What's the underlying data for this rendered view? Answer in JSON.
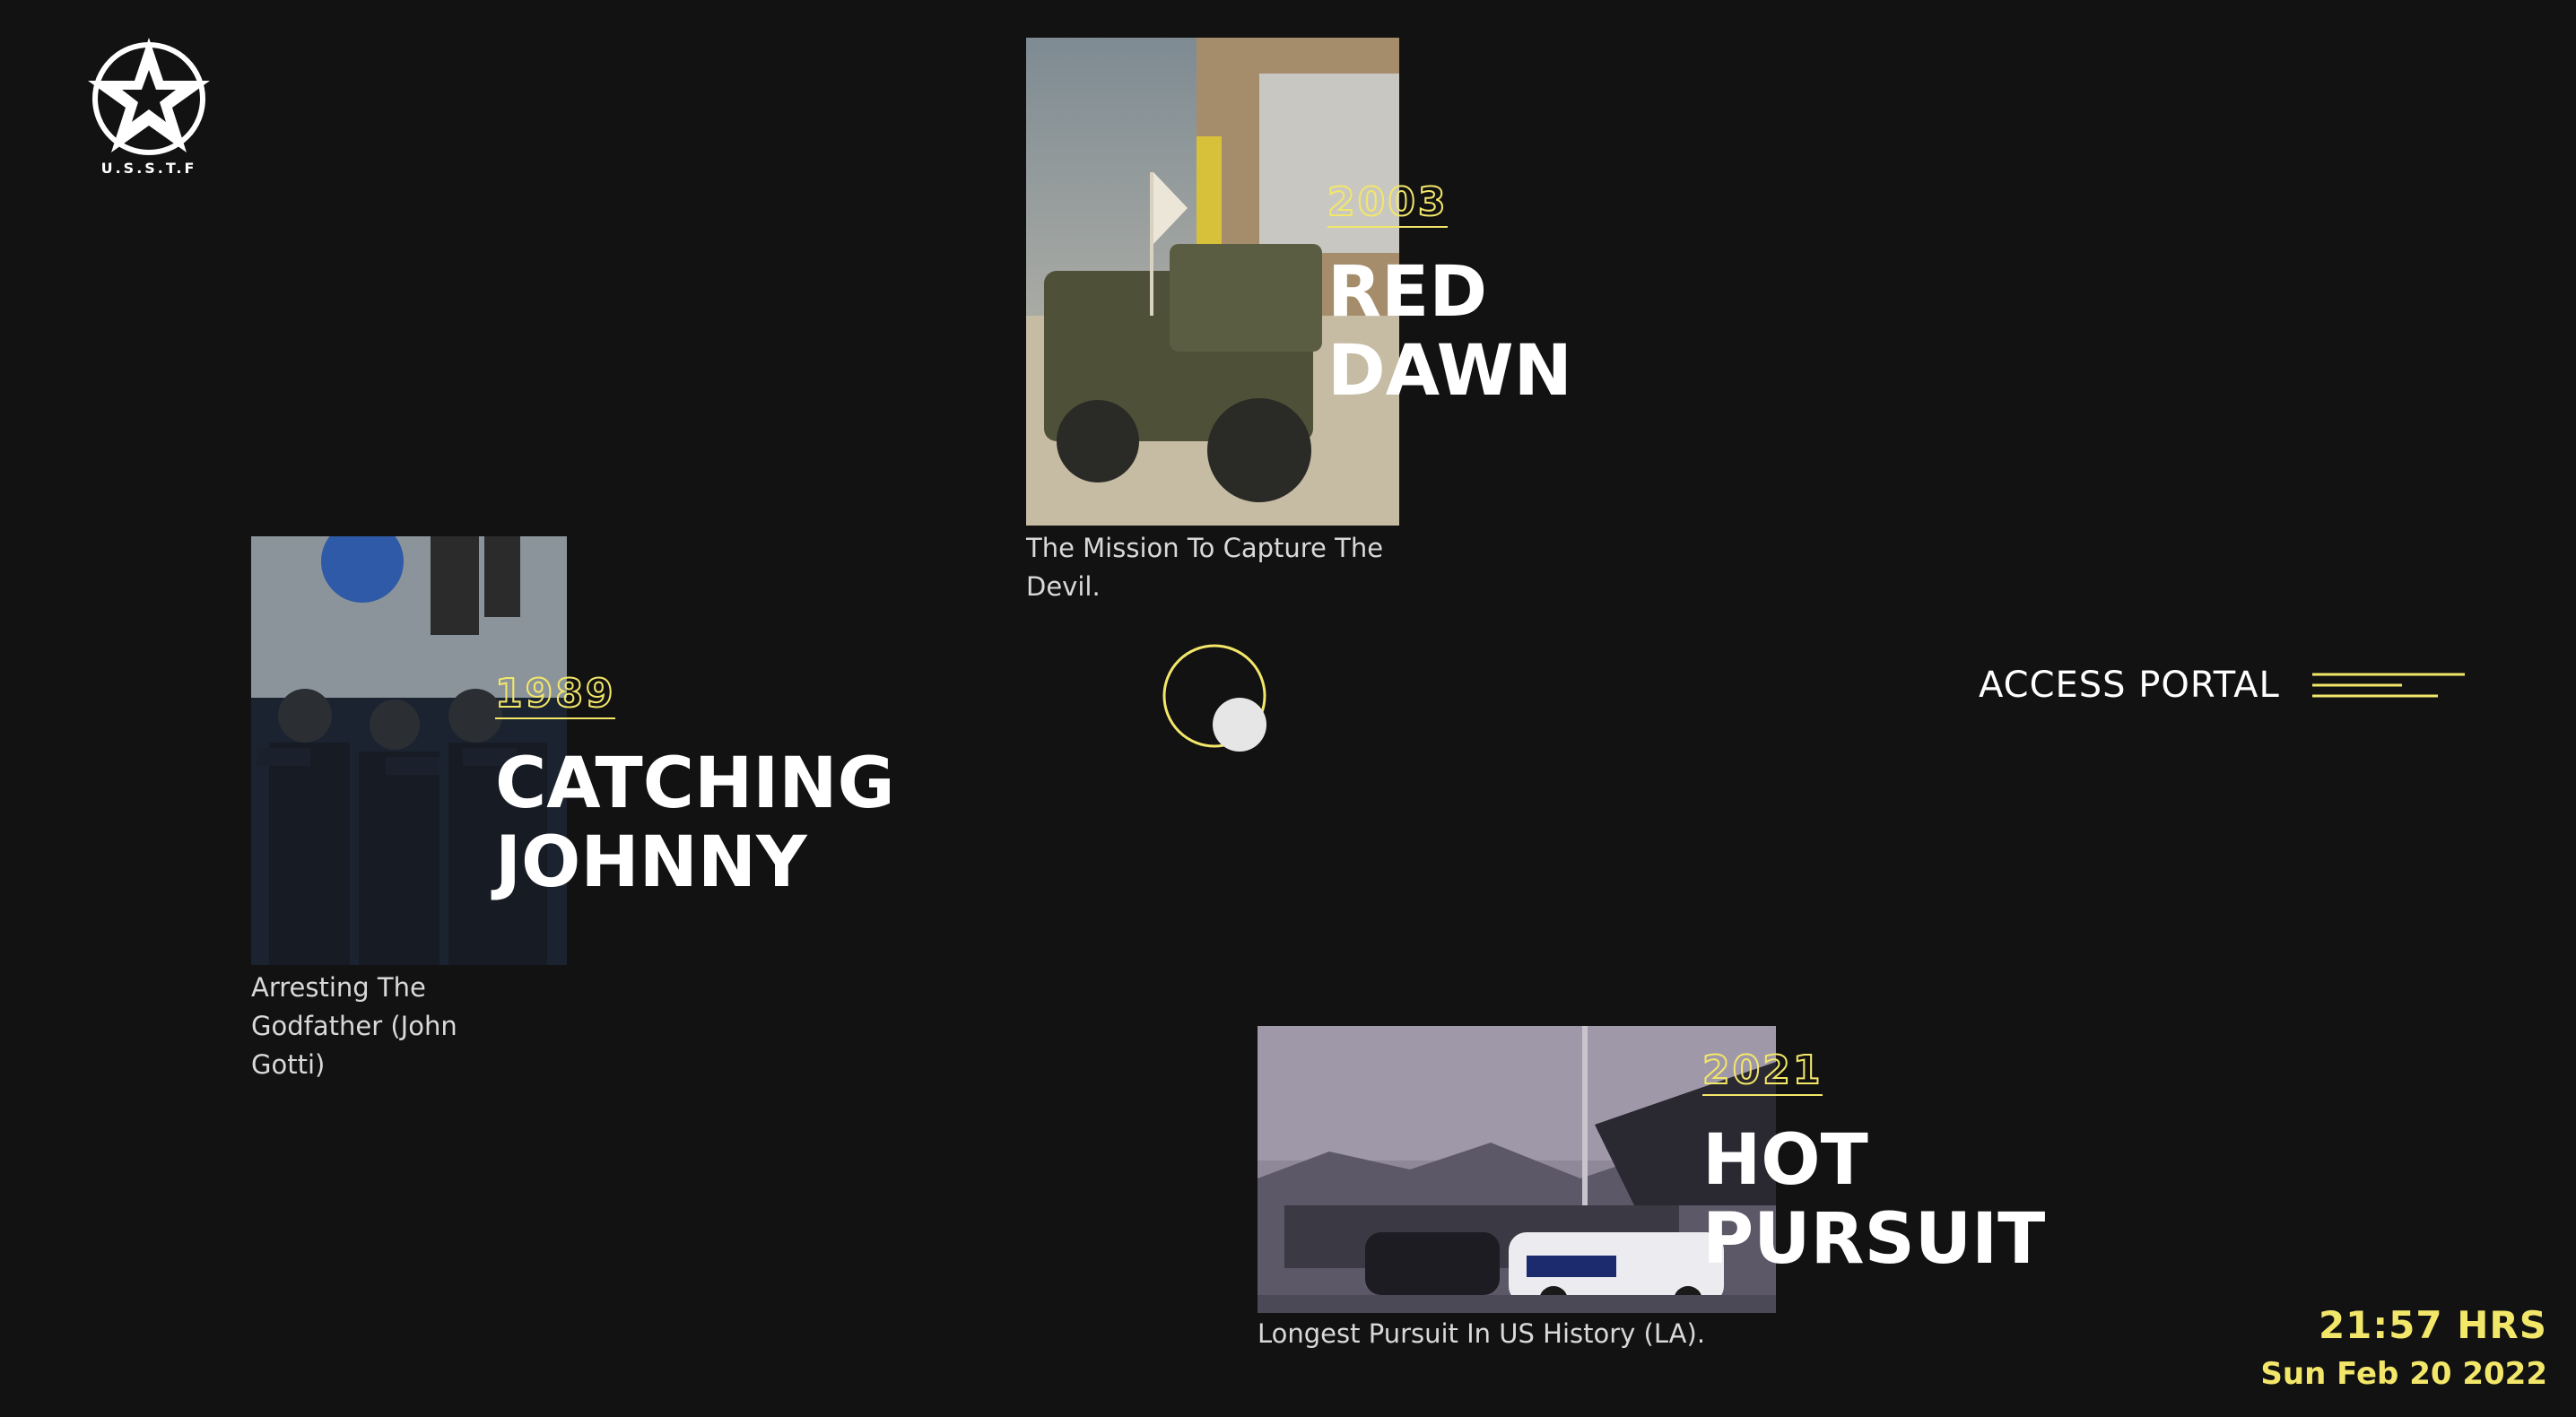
{
  "logo": {
    "text": "U.S.S.T.F"
  },
  "missions": [
    {
      "year": "2003",
      "title_line1": "RED",
      "title_line2": "DAWN",
      "description": "The Mission To Capture The Devil."
    },
    {
      "year": "1989",
      "title_line1": "CATCHING",
      "title_line2": "JOHNNY",
      "description": "Arresting The Godfather (John Gotti)"
    },
    {
      "year": "2021",
      "title_line1": "HOT",
      "title_line2": "PURSUIT",
      "description": "Longest Pursuit In US History (LA)."
    }
  ],
  "portal": {
    "label": "ACCESS PORTAL",
    "icon": "menu-lines-icon"
  },
  "clock": {
    "time": "21:57 HRS",
    "date": "Sun Feb 20 2022"
  },
  "colors": {
    "background": "#121212",
    "accent": "#f3e76a",
    "text": "#ffffff"
  }
}
